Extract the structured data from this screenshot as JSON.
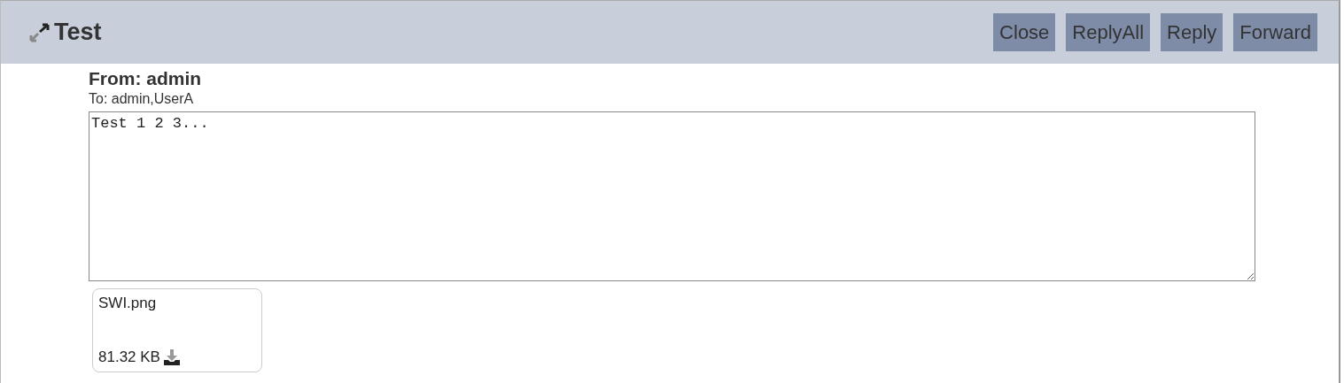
{
  "header": {
    "title": "Test",
    "buttons": [
      "Close",
      "ReplyAll",
      "Reply",
      "Forward"
    ]
  },
  "message": {
    "from": "From: admin",
    "to": "To: admin,UserA",
    "body": "Test 1 2 3..."
  },
  "attachments": [
    {
      "name": "SWI.png",
      "size": "81.32 KB"
    }
  ]
}
